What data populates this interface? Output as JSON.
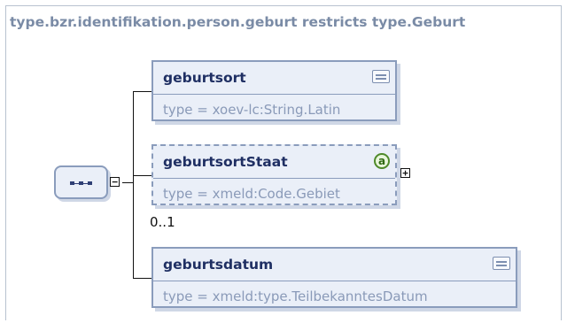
{
  "diagram": {
    "title": "type.bzr.identifikation.person.geburt restricts type.Geburt",
    "sequence": {
      "icon": "sequence-compositor-icon",
      "expander": "−"
    },
    "elements": [
      {
        "name": "geburtsort",
        "type": "type = xoev-lc:String.Latin",
        "icon": "documentation-icon"
      },
      {
        "name": "geburtsortStaat",
        "type": "type = xmeld:Code.Gebiet",
        "icon": "attribute-icon",
        "icon_text": "a",
        "expander": "+",
        "occurrence": "0..1"
      },
      {
        "name": "geburtsdatum",
        "type": "type = xmeld:type.TeilbekanntesDatum",
        "icon": "documentation-icon"
      }
    ]
  }
}
